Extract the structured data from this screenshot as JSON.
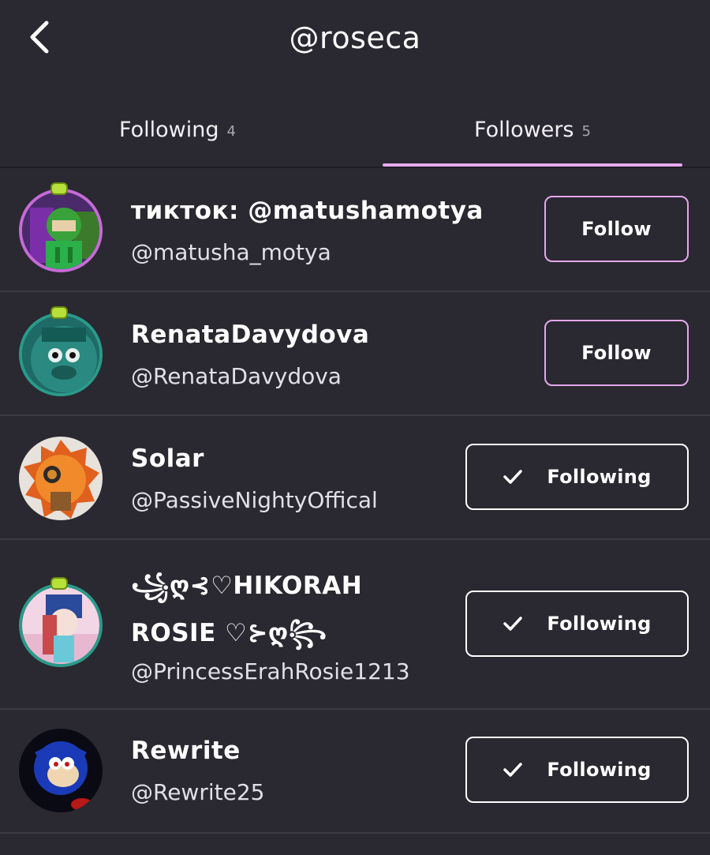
{
  "header": {
    "title": "@roseca",
    "back_icon": "chevron-left-icon"
  },
  "tabs": [
    {
      "label": "Following",
      "count": "4",
      "active": false
    },
    {
      "label": "Followers",
      "count": "5",
      "active": true
    }
  ],
  "colors": {
    "background": "#2a2830",
    "accent": "#e7aaf0",
    "divider": "#3c3a42"
  },
  "users": [
    {
      "name": "тикток: @matushamotya",
      "handle": "@matusha_motya",
      "button": "Follow",
      "following": false
    },
    {
      "name": "RenataDavydova",
      "handle": "@RenataDavydova",
      "button": "Follow",
      "following": false
    },
    {
      "name": "Solar",
      "handle": "@PassiveNightyOffical",
      "button": "Following",
      "following": true
    },
    {
      "name_line1": "꧁ღ⊰♡HIKORAH",
      "name_line2": "ROSIE ♡⊱ღ꧂",
      "handle": "@PrincessErahRosie1213",
      "button": "Following",
      "following": true
    },
    {
      "name": "Rewrite",
      "handle": "@Rewrite25",
      "button": "Following",
      "following": true
    }
  ]
}
